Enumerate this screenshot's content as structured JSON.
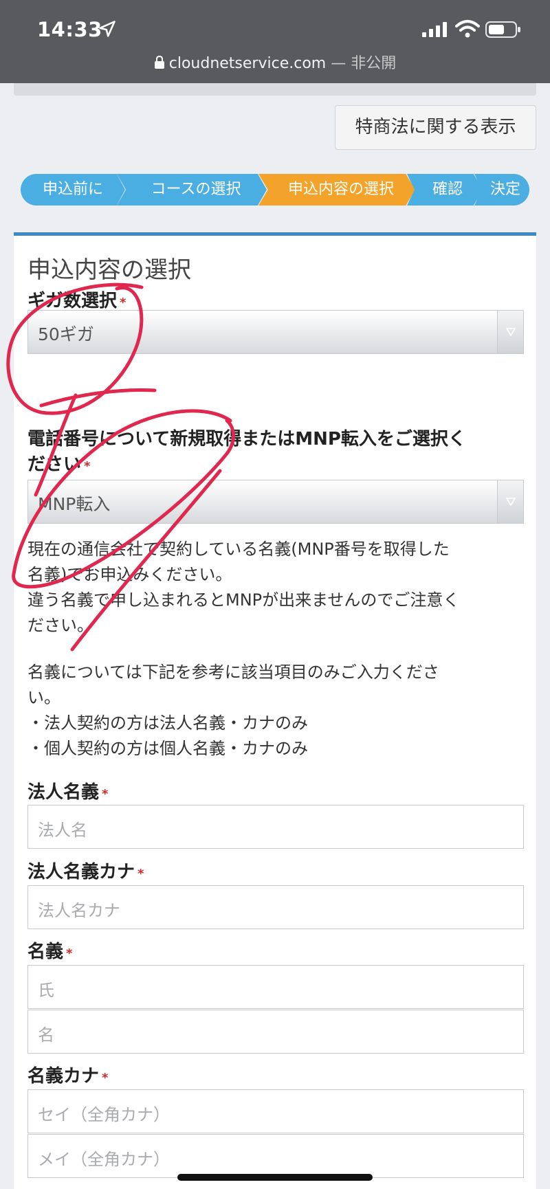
{
  "status_bar": {
    "time": "14:33",
    "url": "cloudnetservice.com",
    "separator": "—",
    "security_note": "非公開"
  },
  "law_button": {
    "label": "特商法に関する表示"
  },
  "steps": [
    {
      "label": "申込前に",
      "active": false
    },
    {
      "label": "コースの選択",
      "active": false
    },
    {
      "label": "申込内容の選択",
      "active": true
    },
    {
      "label": "確認",
      "active": false
    },
    {
      "label": "決定",
      "active": false
    }
  ],
  "form": {
    "title": "申込内容の選択",
    "giga": {
      "label": "ギガ数選択",
      "required_mark": "*",
      "selected": "50ギガ"
    },
    "phone": {
      "label_line1": "電話番号について新規取得またはMNP転入をご選択く",
      "label_line2": "ださい",
      "required_mark": "*",
      "selected": "MNP転入"
    },
    "notice": [
      "現在の通信会社で契約している名義(MNP番号を取得した",
      "名義)でお申込みください。",
      "違う名義で申し込まれるとMNPが出来ませんのでご注意く",
      "ださい。"
    ],
    "name_guide": [
      "名義については下記を参考に該当項目のみご入力くださ",
      "い。",
      "・法人契約の方は法人名義・カナのみ",
      "・個人契約の方は個人名義・カナのみ"
    ],
    "corp_name": {
      "label": "法人名義",
      "required_mark": "*",
      "placeholder": "法人名"
    },
    "corp_kana": {
      "label": "法人名義カナ",
      "required_mark": "*",
      "placeholder": "法人名カナ"
    },
    "name": {
      "label": "名義",
      "required_mark": "*",
      "placeholder_last": "氏",
      "placeholder_first": "名"
    },
    "name_kana": {
      "label": "名義カナ",
      "required_mark": "*",
      "placeholder_last": "セイ（全角カナ）",
      "placeholder_first": "メイ（全角カナ）"
    }
  },
  "colors": {
    "step_default": "#4baee3",
    "step_active": "#f3a32a",
    "card_border": "#3e89c4",
    "required": "#d12a2a",
    "scribble": "#e0284f"
  }
}
